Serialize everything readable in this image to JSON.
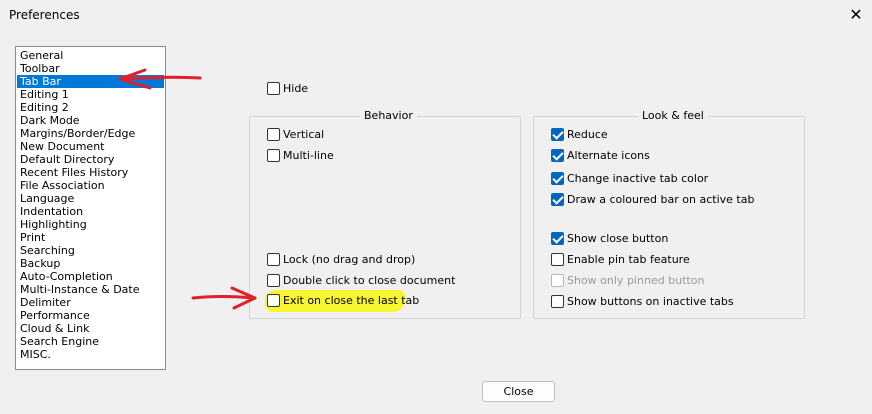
{
  "window": {
    "title": "Preferences",
    "close_glyph": "✕"
  },
  "categories": [
    {
      "label": "General",
      "selected": false
    },
    {
      "label": "Toolbar",
      "selected": false
    },
    {
      "label": "Tab Bar",
      "selected": true
    },
    {
      "label": "Editing 1",
      "selected": false
    },
    {
      "label": "Editing 2",
      "selected": false
    },
    {
      "label": "Dark Mode",
      "selected": false
    },
    {
      "label": "Margins/Border/Edge",
      "selected": false
    },
    {
      "label": "New Document",
      "selected": false
    },
    {
      "label": "Default Directory",
      "selected": false
    },
    {
      "label": "Recent Files History",
      "selected": false
    },
    {
      "label": "File Association",
      "selected": false
    },
    {
      "label": "Language",
      "selected": false
    },
    {
      "label": "Indentation",
      "selected": false
    },
    {
      "label": "Highlighting",
      "selected": false
    },
    {
      "label": "Print",
      "selected": false
    },
    {
      "label": "Searching",
      "selected": false
    },
    {
      "label": "Backup",
      "selected": false
    },
    {
      "label": "Auto-Completion",
      "selected": false
    },
    {
      "label": "Multi-Instance & Date",
      "selected": false
    },
    {
      "label": "Delimiter",
      "selected": false
    },
    {
      "label": "Performance",
      "selected": false
    },
    {
      "label": "Cloud & Link",
      "selected": false
    },
    {
      "label": "Search Engine",
      "selected": false
    },
    {
      "label": "MISC.",
      "selected": false
    }
  ],
  "hide": {
    "label": "Hide",
    "checked": false
  },
  "behavior": {
    "title": "Behavior",
    "vertical": {
      "label": "Vertical",
      "checked": false
    },
    "multiline": {
      "label": "Multi-line",
      "checked": false
    },
    "lock": {
      "label": "Lock (no drag and drop)",
      "checked": false
    },
    "double_click": {
      "label": "Double click to close document",
      "checked": false
    },
    "exit_last": {
      "label": "Exit on close the last tab",
      "checked": false
    }
  },
  "look": {
    "title": "Look & feel",
    "reduce": {
      "label": "Reduce",
      "checked": true
    },
    "alt_icons": {
      "label": "Alternate icons",
      "checked": true
    },
    "inactive_color": {
      "label": "Change inactive tab color",
      "checked": true
    },
    "colored_bar": {
      "label": "Draw a coloured bar on active tab",
      "checked": true
    },
    "show_close": {
      "label": "Show close button",
      "checked": true
    },
    "pin_tab": {
      "label": "Enable pin tab feature",
      "checked": false
    },
    "only_pinned": {
      "label": "Show only pinned button",
      "checked": false,
      "disabled": true
    },
    "inactive_buttons": {
      "label": "Show buttons on inactive tabs",
      "checked": false
    }
  },
  "footer": {
    "close_label": "Close"
  },
  "colors": {
    "selection": "#0078d7",
    "checkbox": "#0067c0",
    "annotation_arrow": "#e0202a",
    "highlight": "#f8f531"
  }
}
